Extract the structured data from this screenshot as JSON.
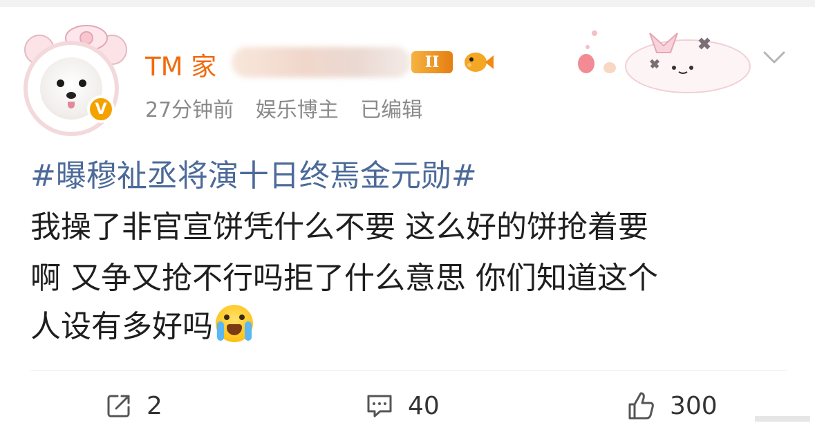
{
  "post": {
    "username_visible": "TM",
    "username_partial_char": "家",
    "level_badge": "II",
    "meta": {
      "time": "27分钟前",
      "role": "娱乐博主",
      "edited": "已编辑"
    },
    "topic": "#曝穆祉丞将演十日终焉金元勋#",
    "body_lines": [
      "我操了非官宣饼凭什么不要 这么好的饼抢着要",
      "啊 又争又抢不行吗拒了什么意思 你们知道这个",
      "人设有多好吗"
    ],
    "emoji": "crying-face-emoji"
  },
  "actions": {
    "share_count": "2",
    "comment_count": "40",
    "like_count": "300"
  },
  "colors": {
    "username": "#f16b0e",
    "topic": "#4c6a99",
    "meta": "#8a8a8a",
    "verify_badge": "#f4a200"
  },
  "icons": {
    "share": "share-icon",
    "comment": "comment-icon",
    "like": "thumbs-up-icon",
    "more": "chevron-down-icon"
  }
}
